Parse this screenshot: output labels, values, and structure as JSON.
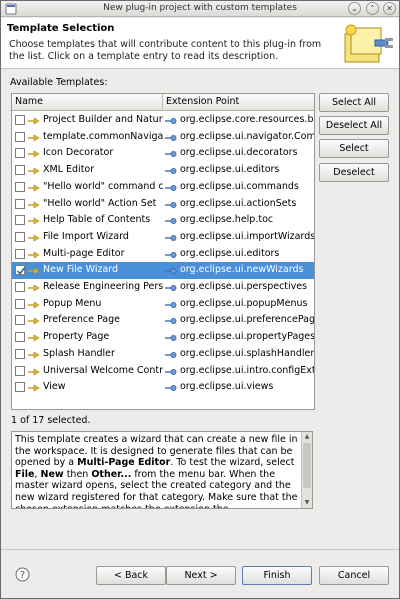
{
  "window": {
    "title": "New plug-in project with custom templates"
  },
  "header": {
    "title": "Template Selection",
    "description": "Choose templates that will contribute content to this plug-in from the list. Click on a template entry to read its description."
  },
  "available_label": "Available Templates:",
  "table": {
    "columns": [
      "Name",
      "Extension Point"
    ],
    "rows": [
      {
        "name": "Project Builder and Nature",
        "ext": "org.eclipse.core.resources.builders",
        "checked": false,
        "selected": false
      },
      {
        "name": "template.commonNavigator",
        "ext": "org.eclipse.ui.navigator.Common",
        "checked": false,
        "selected": false
      },
      {
        "name": "Icon Decorator",
        "ext": "org.eclipse.ui.decorators",
        "checked": false,
        "selected": false
      },
      {
        "name": "XML Editor",
        "ext": "org.eclipse.ui.editors",
        "checked": false,
        "selected": false
      },
      {
        "name": "\"Hello world\" command contribution",
        "ext": "org.eclipse.ui.commands",
        "checked": false,
        "selected": false
      },
      {
        "name": "\"Hello world\" Action Set",
        "ext": "org.eclipse.ui.actionSets",
        "checked": false,
        "selected": false
      },
      {
        "name": "Help Table of Contents",
        "ext": "org.eclipse.help.toc",
        "checked": false,
        "selected": false
      },
      {
        "name": "File Import Wizard",
        "ext": "org.eclipse.ui.importWizards",
        "checked": false,
        "selected": false
      },
      {
        "name": "Multi-page Editor",
        "ext": "org.eclipse.ui.editors",
        "checked": false,
        "selected": false
      },
      {
        "name": "New File Wizard",
        "ext": "org.eclipse.ui.newWizards",
        "checked": true,
        "selected": true
      },
      {
        "name": "Release Engineering Perspective",
        "ext": "org.eclipse.ui.perspectives",
        "checked": false,
        "selected": false
      },
      {
        "name": "Popup Menu",
        "ext": "org.eclipse.ui.popupMenus",
        "checked": false,
        "selected": false
      },
      {
        "name": "Preference Page",
        "ext": "org.eclipse.ui.preferencePages",
        "checked": false,
        "selected": false
      },
      {
        "name": "Property Page",
        "ext": "org.eclipse.ui.propertyPages",
        "checked": false,
        "selected": false
      },
      {
        "name": "Splash Handler",
        "ext": "org.eclipse.ui.splashHandlers",
        "checked": false,
        "selected": false
      },
      {
        "name": "Universal Welcome Contribution",
        "ext": "org.eclipse.ui.intro.configExtension",
        "checked": false,
        "selected": false
      },
      {
        "name": "View",
        "ext": "org.eclipse.ui.views",
        "checked": false,
        "selected": false
      }
    ]
  },
  "side_buttons": {
    "select_all": "Select All",
    "deselect_all": "Deselect All",
    "select": "Select",
    "deselect": "Deselect"
  },
  "selection_count": "1 of 17 selected.",
  "description_box": {
    "p1": "This template creates a wizard that can create a new file in the workspace. It is designed to generate files that can be opened by a ",
    "p1_bold": "Multi-Page Editor",
    "p2": ". To test the wizard, select ",
    "p2_b1": "File",
    "p2_c": ", ",
    "p2_b2": "New",
    "p2_d": " then ",
    "p2_b3": "Other...",
    "p3": " from the menu bar. When the master wizard opens, select the created category and the new wizard registered for that category. Make sure that the chosen extension matches the extension the"
  },
  "footer": {
    "back": "< Back",
    "next": "Next >",
    "finish": "Finish",
    "cancel": "Cancel"
  },
  "colors": {
    "selection": "#4a90d9",
    "dialog_bg": "#edeceb"
  }
}
